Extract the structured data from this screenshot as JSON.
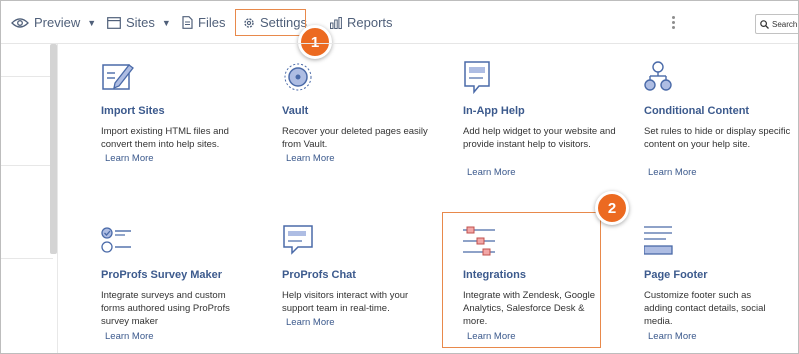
{
  "toolbar": {
    "preview_label": "Preview",
    "sites_label": "Sites",
    "files_label": "Files",
    "settings_label": "Settings",
    "reports_label": "Reports",
    "search_placeholder": "Search"
  },
  "badges": {
    "first": "1",
    "second": "2"
  },
  "cards": [
    {
      "title": "Import Sites",
      "desc": "Import existing HTML files and convert them into help sites.",
      "link": "Learn More",
      "icon": "import-sites-icon"
    },
    {
      "title": "Vault",
      "desc": "Recover your deleted pages easily from Vault.",
      "link": "Learn More",
      "icon": "vault-icon"
    },
    {
      "title": "In-App Help",
      "desc": "Add help widget to your website and provide instant help to visitors.",
      "link": "Learn More",
      "icon": "in-app-help-icon"
    },
    {
      "title": "Conditional Content",
      "desc": "Set rules to hide or display specific content on your help site.",
      "link": "Learn More",
      "icon": "conditional-content-icon"
    },
    {
      "title": "ProProfs Survey Maker",
      "desc": "Integrate surveys and custom forms authored using ProProfs survey maker",
      "link": "Learn More",
      "icon": "survey-maker-icon"
    },
    {
      "title": "ProProfs Chat",
      "desc": "Help visitors interact with your support team in real-time.",
      "link": "Learn More",
      "icon": "chat-icon"
    },
    {
      "title": "Integrations",
      "desc": "Integrate with Zendesk, Google Analytics, Salesforce Desk & more.",
      "link": "Learn More",
      "icon": "integrations-icon"
    },
    {
      "title": "Page Footer",
      "desc": "Customize footer such as adding contact details, social media.",
      "link": "Learn More",
      "icon": "page-footer-icon"
    }
  ],
  "colors": {
    "highlight": "#e8894b",
    "badge": "#ec6a21",
    "link": "#3c5a8d",
    "icon_blue": "#4a6aa8",
    "icon_fill": "#aebde3"
  }
}
